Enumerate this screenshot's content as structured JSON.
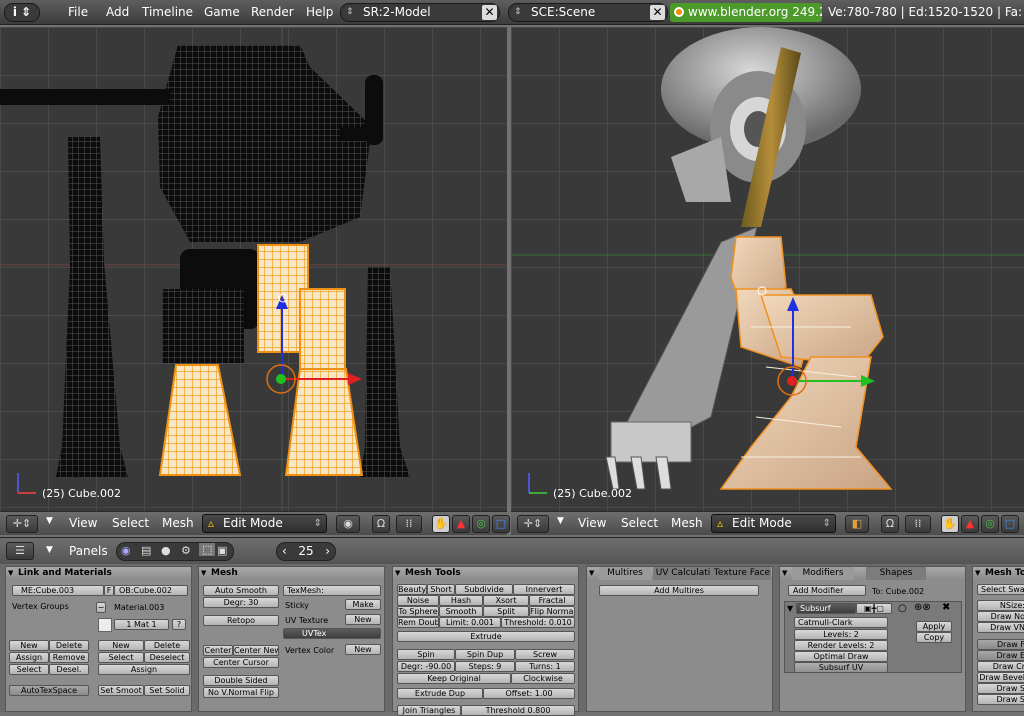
{
  "menubar": {
    "info_icon": "info-icon",
    "items": [
      "File",
      "Add",
      "Timeline",
      "Game",
      "Render",
      "Help"
    ],
    "screen": "SR:2-Model",
    "scene": "SCE:Scene",
    "url": "www.blender.org 249.2",
    "stats": "Ve:780-780 | Ed:1520-1520 | Fa:"
  },
  "viewport_left": {
    "object_label": "(25) Cube.002"
  },
  "viewport_right": {
    "object_label": "(25) Cube.002"
  },
  "header_left": {
    "view": "View",
    "select": "Select",
    "mesh": "Mesh",
    "mode": "Edit Mode"
  },
  "header_right": {
    "view": "View",
    "select": "Select",
    "mesh": "Mesh",
    "mode": "Edit Mode"
  },
  "buttons_header": {
    "panels": "Panels",
    "frame": "25"
  },
  "link_materials": {
    "title": "Link and Materials",
    "me": "ME:Cube.003",
    "f": "F",
    "ob": "OB:Cube.002",
    "vertex_groups": "Vertex Groups",
    "material": "Material.003",
    "mat_index": "1 Mat 1",
    "q": "?",
    "new": "New",
    "delete": "Delete",
    "assign": "Assign",
    "remove": "Remove",
    "select": "Select",
    "desel": "Desel.",
    "new2": "New",
    "delete2": "Delete",
    "select2": "Select",
    "deselect": "Deselect",
    "assign2": "Assign",
    "autotexspace": "AutoTexSpace",
    "set_smooth": "Set Smoot",
    "set_solid": "Set Solid"
  },
  "mesh": {
    "title": "Mesh",
    "auto_smooth": "Auto Smooth",
    "degr": "Degr: 30",
    "retopo": "Retopo",
    "texmesh": "TexMesh:",
    "sticky": "Sticky",
    "make": "Make",
    "uv_texture": "UV Texture",
    "new": "New",
    "uvtex": "UVTex",
    "vertex_color": "Vertex Color",
    "new2": "New",
    "center_new": "Center",
    "center_new2": "Center New",
    "center_cursor": "Center Cursor",
    "double_sided": "Double Sided",
    "no_v_normal_flip": "No V.Normal Flip"
  },
  "mesh_tools": {
    "title": "Mesh Tools",
    "beauty": "Beauty",
    "short": "Short",
    "subdivide": "Subdivide",
    "innervert": "Innervert",
    "noise": "Noise",
    "hash": "Hash",
    "xsort": "Xsort",
    "fractal": "Fractal",
    "to_sphere": "To Sphere",
    "smooth": "Smooth",
    "split": "Split",
    "flip_normal": "Flip Normal",
    "rem_doubl": "Rem Doubl",
    "limit": "Limit: 0.001",
    "threshold": "Threshold: 0.010",
    "extrude": "Extrude",
    "spin": "Spin",
    "spin_dup": "Spin Dup",
    "screw": "Screw",
    "degr": "Degr: -90.00",
    "steps": "Steps: 9",
    "turns": "Turns: 1",
    "keep_original": "Keep Original",
    "clockwise": "Clockwise",
    "extrude_dup": "Extrude Dup",
    "offset": "Offset: 1.00",
    "join_triangles": "Join Triangles",
    "threshold2": "Threshold 0.800"
  },
  "multires": {
    "tabs": [
      "Multires",
      "UV Calculati",
      "Texture Face"
    ],
    "add_multires": "Add Multires"
  },
  "modifiers": {
    "tabs": [
      "Modifiers",
      "Shapes"
    ],
    "add_modifier": "Add Modifier",
    "to": "To: Cube.002",
    "subsurf": "Subsurf",
    "catmull": "Catmull-Clark",
    "levels": "Levels: 2",
    "render_levels": "Render Levels: 2",
    "optimal_draw": "Optimal Draw",
    "subsurf_uv": "Subsurf UV",
    "apply": "Apply",
    "copy": "Copy"
  },
  "mesh_tools_more": {
    "title": "Mesh Too",
    "select_swap": "Select Swa",
    "nsize": "NSize:",
    "draw_no": "Draw No",
    "draw_vn": "Draw VN",
    "draw_f": "Draw F",
    "draw_e": "Draw E",
    "draw_cr": "Draw Cr",
    "draw_bevel": "Draw Bevel",
    "draw_s": "Draw S",
    "draw_s2": "Draw S"
  }
}
